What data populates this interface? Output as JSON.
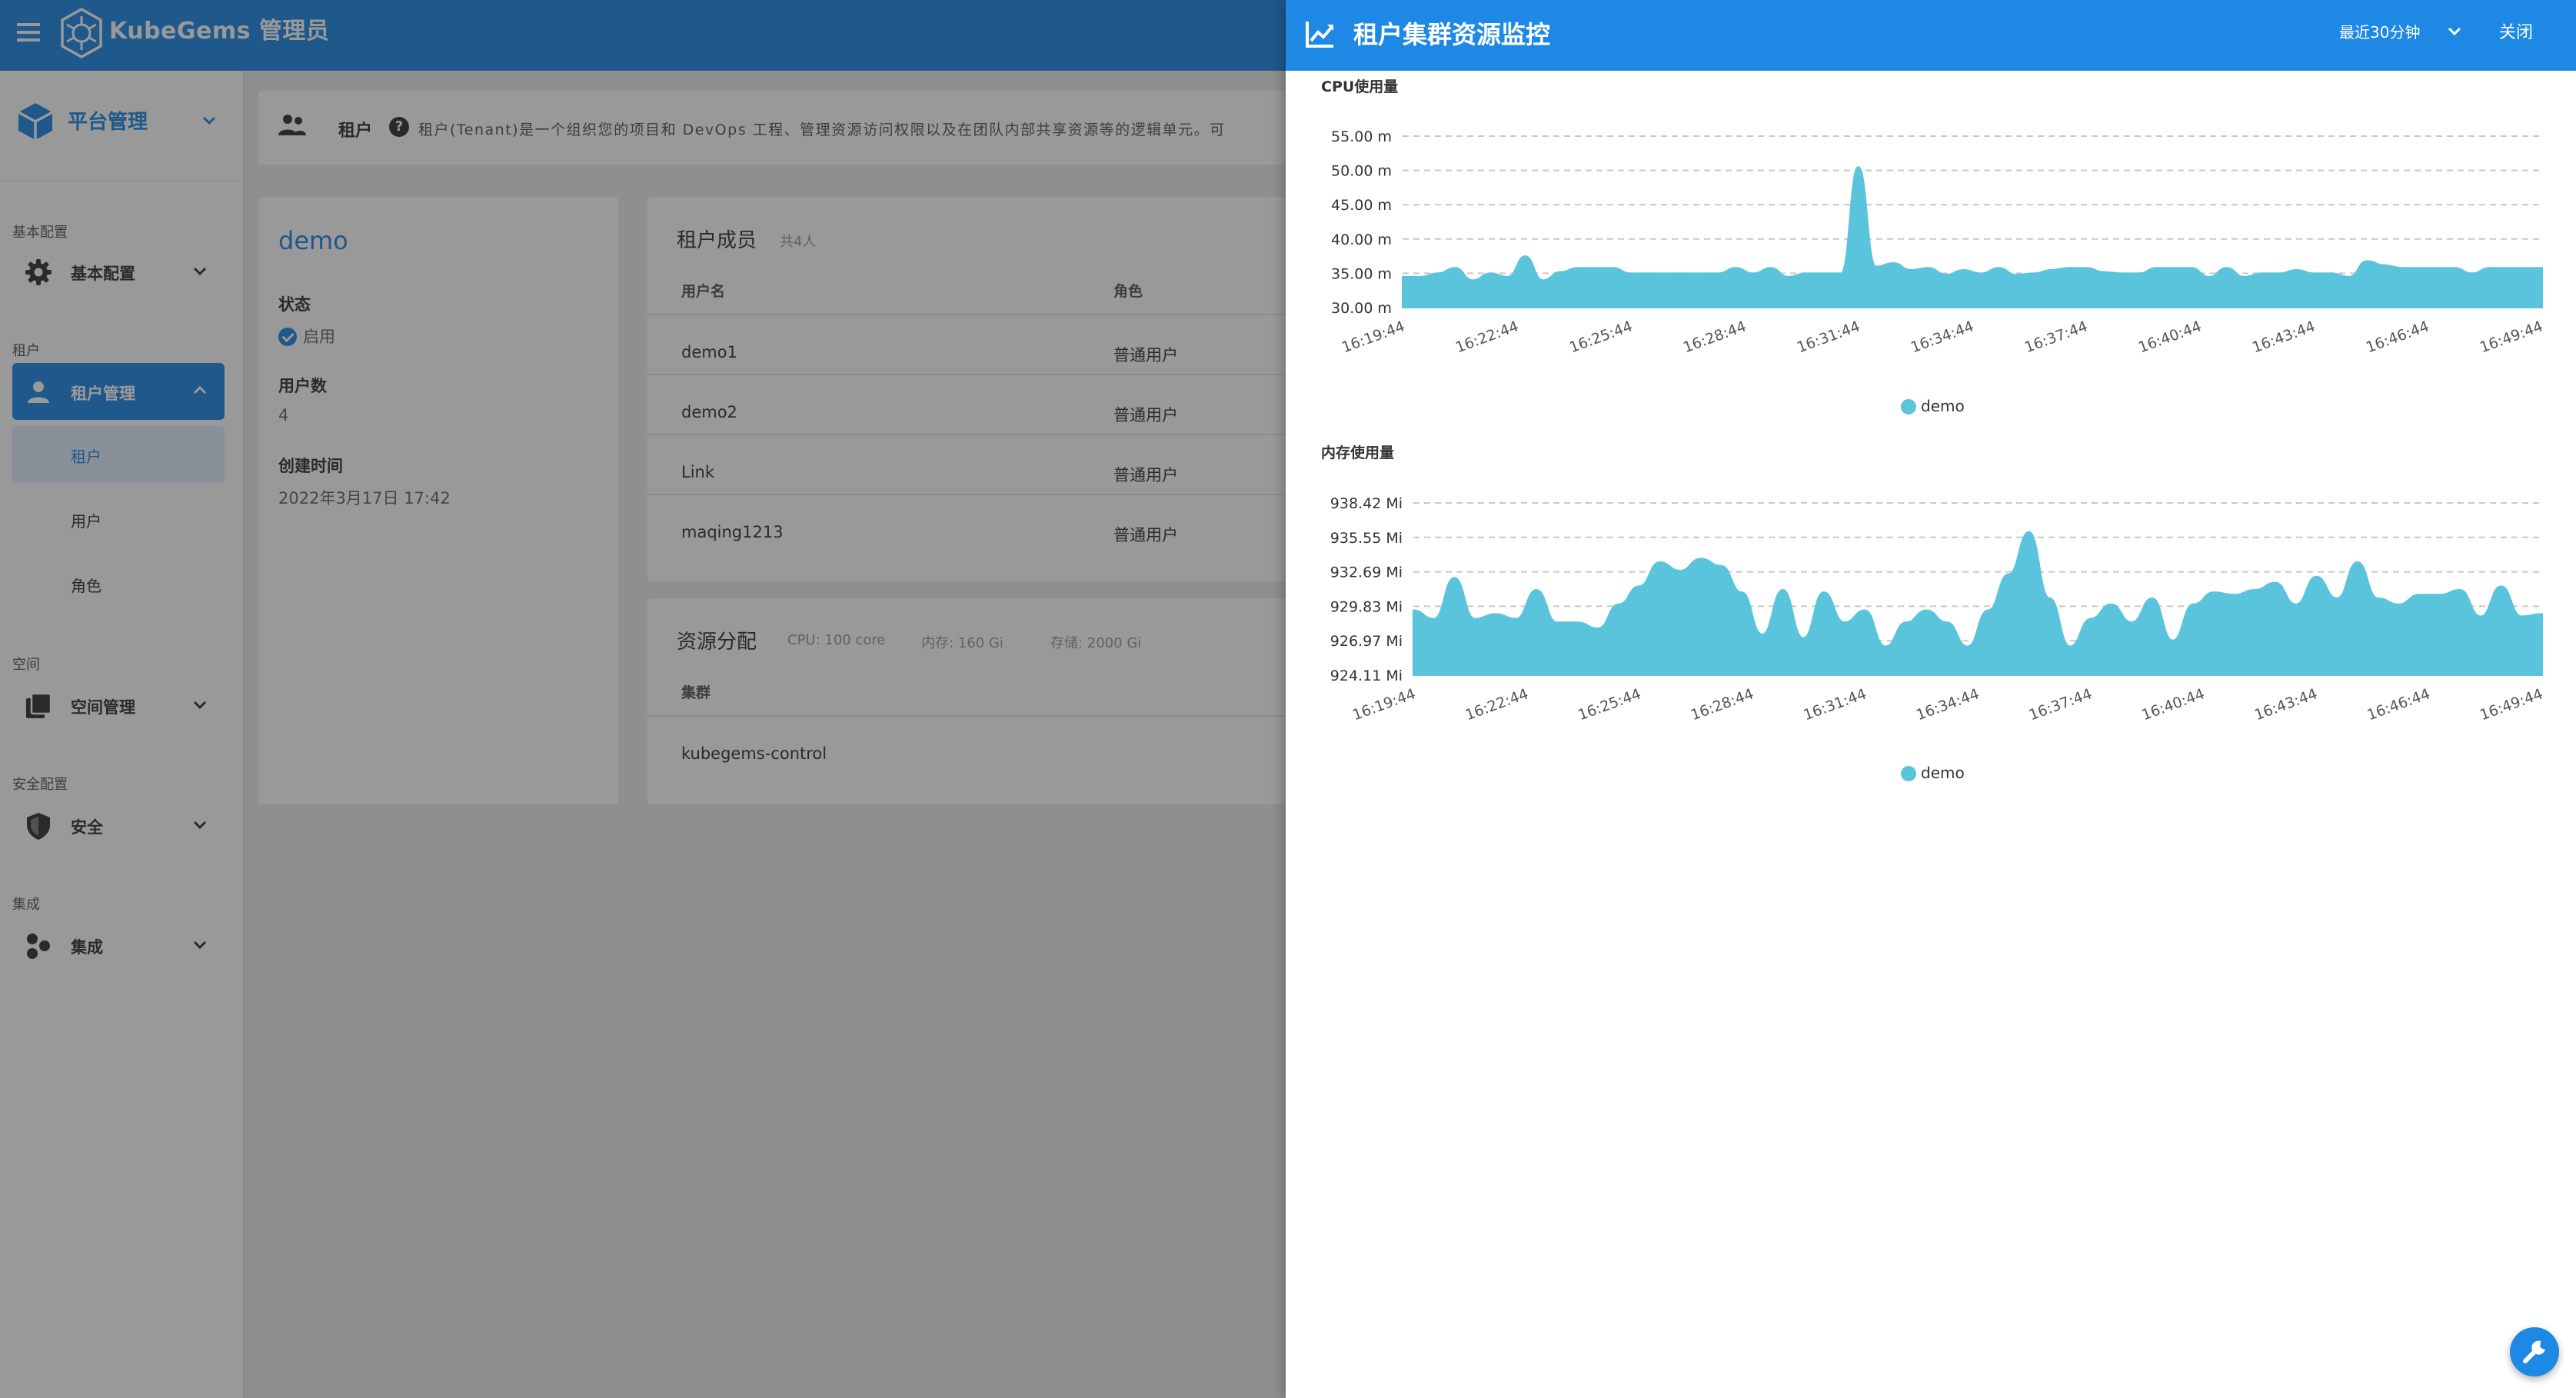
{
  "app": {
    "brand": "KubeGems 管理员"
  },
  "sidebar": {
    "header_label": "平台管理",
    "sections": [
      {
        "title": "基本配置",
        "item": "基本配置"
      },
      {
        "title": "租户",
        "item": "租户管理",
        "subitems": [
          "租户",
          "用户",
          "角色"
        ]
      },
      {
        "title": "空间",
        "item": "空间管理"
      },
      {
        "title": "安全配置",
        "item": "安全"
      },
      {
        "title": "集成",
        "item": "集成"
      }
    ]
  },
  "breadcrumb": {
    "title": "租户",
    "help": "?",
    "description": "租户(Tenant)是一个组织您的项目和 DevOps 工程、管理资源访问权限以及在团队内部共享资源等的逻辑单元。可"
  },
  "tenant": {
    "name": "demo",
    "fields": [
      {
        "label": "状态",
        "value": "启用"
      },
      {
        "label": "用户数",
        "value": "4"
      },
      {
        "label": "创建时间",
        "value": "2022年3月17日 17:42"
      }
    ]
  },
  "members": {
    "title": "租户成员",
    "count": "共4人",
    "columns": [
      "用户名",
      "角色"
    ],
    "rows": [
      [
        "demo1",
        "普通用户"
      ],
      [
        "demo2",
        "普通用户"
      ],
      [
        "Link",
        "普通用户"
      ],
      [
        "maqing1213",
        "普通用户"
      ]
    ]
  },
  "resources": {
    "title": "资源分配",
    "summary": [
      {
        "label": "CPU: 100",
        "unit": "core"
      },
      {
        "label": "内存: 160",
        "unit": "Gi"
      },
      {
        "label": "存储: 2000",
        "unit": "Gi"
      }
    ],
    "columns": [
      "集群"
    ],
    "rows": [
      [
        "kubegems-control"
      ]
    ]
  },
  "drawer": {
    "title": "租户集群资源监控",
    "range": "最近30分钟",
    "close": "关闭"
  },
  "colors": {
    "primary": "#1e88e5",
    "series": "#5bc4dd"
  },
  "chart_data": [
    {
      "type": "area",
      "title": "CPU使用量",
      "y_ticks": [
        "30.00 m",
        "35.00 m",
        "40.00 m",
        "45.00 m",
        "50.00 m",
        "55.00 m"
      ],
      "ylim": [
        30,
        55
      ],
      "x_ticks": [
        "16:19:44",
        "16:22:44",
        "16:25:44",
        "16:28:44",
        "16:31:44",
        "16:34:44",
        "16:37:44",
        "16:40:44",
        "16:43:44",
        "16:46:44",
        "16:49:44"
      ],
      "series": [
        {
          "name": "demo",
          "values": [
            34.5,
            34.5,
            35.0,
            35.8,
            34.0,
            35.0,
            34.5,
            37.5,
            34.0,
            35.2,
            35.8,
            35.8,
            35.8,
            35.0,
            35.0,
            35.0,
            35.0,
            35.0,
            35.0,
            35.8,
            35.0,
            35.8,
            34.5,
            35.0,
            35.0,
            35.0,
            50.5,
            36.0,
            36.5,
            35.5,
            35.8,
            34.8,
            35.5,
            35.0,
            35.8,
            34.8,
            35.0,
            35.5,
            35.8,
            35.8,
            35.2,
            35.0,
            35.0,
            35.8,
            35.8,
            35.8,
            34.5,
            35.8,
            34.5,
            35.0,
            35.0,
            35.5,
            35.0,
            35.0,
            34.5,
            36.8,
            36.2,
            35.8,
            35.8,
            35.8,
            35.8,
            35.0,
            35.8,
            35.8,
            35.8,
            35.8
          ]
        }
      ]
    },
    {
      "type": "area",
      "title": "内存使用量",
      "y_ticks": [
        "924.11 Mi",
        "926.97 Mi",
        "929.83 Mi",
        "932.69 Mi",
        "935.55 Mi",
        "938.42 Mi"
      ],
      "ylim": [
        924.11,
        938.42
      ],
      "x_ticks": [
        "16:19:44",
        "16:22:44",
        "16:25:44",
        "16:28:44",
        "16:31:44",
        "16:34:44",
        "16:37:44",
        "16:40:44",
        "16:43:44",
        "16:46:44",
        "16:49:44"
      ],
      "series": [
        {
          "name": "demo",
          "values": [
            929.5,
            928.8,
            932.2,
            928.8,
            929.2,
            928.8,
            931.2,
            928.5,
            928.5,
            928.0,
            930.0,
            931.5,
            933.5,
            932.8,
            933.8,
            933.2,
            931.0,
            927.5,
            931.2,
            927.2,
            931.0,
            928.5,
            929.5,
            926.5,
            928.5,
            929.5,
            928.5,
            926.5,
            929.5,
            932.5,
            936.0,
            930.5,
            926.5,
            928.8,
            930.0,
            928.5,
            930.5,
            927.0,
            930.0,
            931.0,
            930.8,
            931.2,
            931.8,
            930.0,
            932.3,
            930.5,
            933.5,
            930.5,
            930.0,
            930.8,
            930.8,
            931.2,
            929.0,
            931.5,
            929.0,
            929.2
          ]
        }
      ]
    }
  ]
}
